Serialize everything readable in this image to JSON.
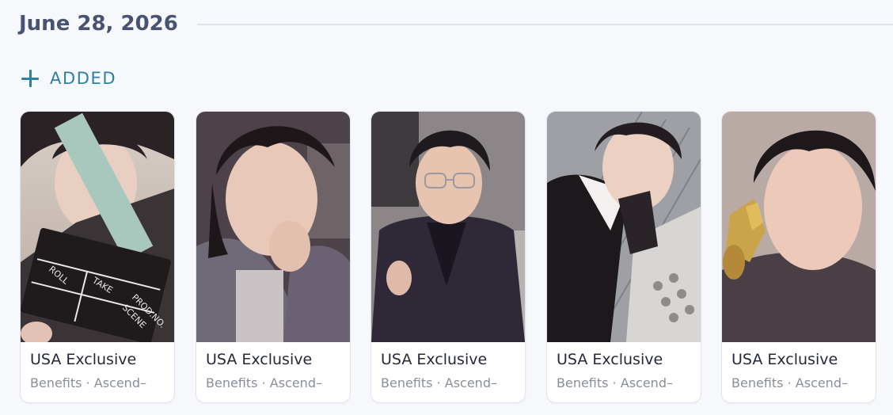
{
  "section": {
    "date": "June 28, 2026",
    "added_label": "ADDED"
  },
  "cards": [
    {
      "title": "USA Exclusive",
      "subtitle": "Benefits · Ascend–",
      "photo_note": "Clapperboard"
    },
    {
      "title": "USA Exclusive",
      "subtitle": "Benefits · Ascend–"
    },
    {
      "title": "USA Exclusive",
      "subtitle": "Benefits · Ascend–"
    },
    {
      "title": "USA Exclusive",
      "subtitle": "Benefits · Ascend–"
    },
    {
      "title": "USA Exclusive",
      "subtitle": "Benefits · Ascend–"
    }
  ],
  "colors": {
    "background": "#f7f8fc",
    "accent": "#2f7fa1",
    "heading": "#4a5272"
  }
}
